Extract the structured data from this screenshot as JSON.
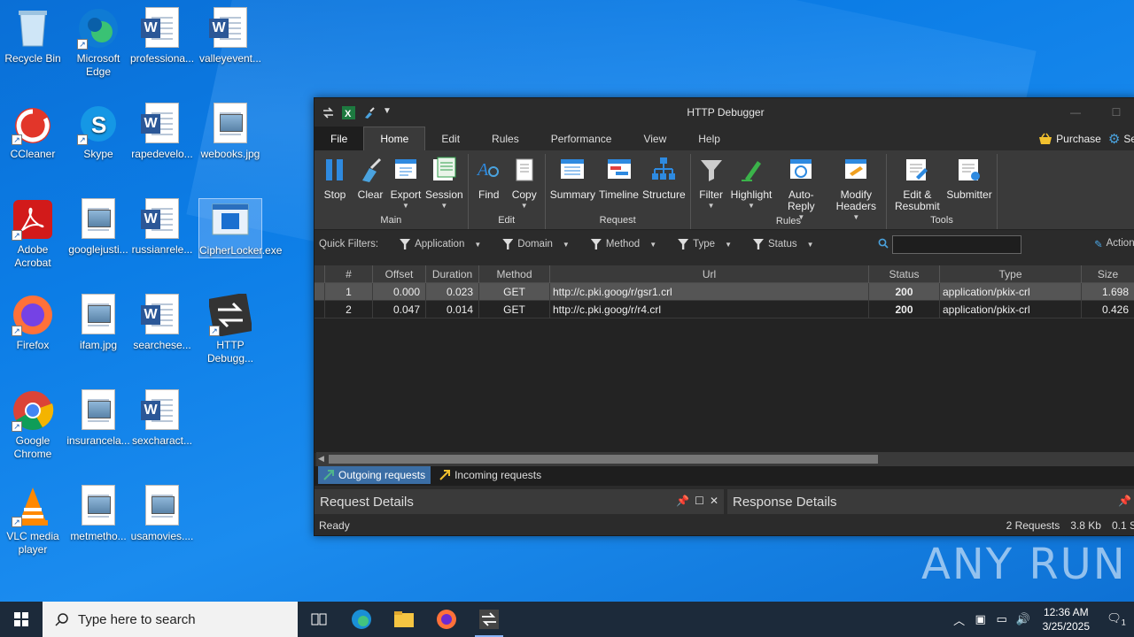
{
  "desktop": {
    "icons": [
      {
        "label": "Recycle Bin",
        "icon": "recycle-bin-icon"
      },
      {
        "label": "Microsoft Edge",
        "icon": "edge-icon"
      },
      {
        "label": "professiona...",
        "icon": "word-doc-icon"
      },
      {
        "label": "valleyevent...",
        "icon": "word-doc-icon"
      },
      {
        "label": "CCleaner",
        "icon": "ccleaner-icon"
      },
      {
        "label": "Skype",
        "icon": "skype-icon"
      },
      {
        "label": "rapedevelo...",
        "icon": "word-doc-icon"
      },
      {
        "label": "webooks.jpg",
        "icon": "image-file-icon"
      },
      {
        "label": "Adobe Acrobat",
        "icon": "acrobat-icon"
      },
      {
        "label": "googlejusti...",
        "icon": "image-file-icon"
      },
      {
        "label": "russianrele...",
        "icon": "word-doc-icon"
      },
      {
        "label": "CipherLocker.exe",
        "icon": "exe-icon"
      },
      {
        "label": "Firefox",
        "icon": "firefox-icon"
      },
      {
        "label": "ifam.jpg",
        "icon": "image-file-icon"
      },
      {
        "label": "searchese...",
        "icon": "word-doc-icon"
      },
      {
        "label": "HTTP Debugg...",
        "icon": "http-debugger-icon"
      },
      {
        "label": "Google Chrome",
        "icon": "chrome-icon"
      },
      {
        "label": "insurancela...",
        "icon": "image-file-icon"
      },
      {
        "label": "sexcharact...",
        "icon": "word-doc-icon"
      },
      {
        "label": "VLC media player",
        "icon": "vlc-icon"
      },
      {
        "label": "metmetho...",
        "icon": "image-file-icon"
      },
      {
        "label": "usamovies....",
        "icon": "image-file-icon"
      }
    ]
  },
  "window": {
    "title": "HTTP Debugger",
    "menu": {
      "file": "File",
      "items": [
        "Home",
        "Edit",
        "Rules",
        "Performance",
        "View",
        "Help"
      ],
      "active": "Home",
      "purchase": "Purchase",
      "settings": "Se"
    },
    "ribbon": {
      "groups": [
        {
          "label": "Main",
          "buttons": [
            {
              "label": "Stop",
              "icon": "stop-icon",
              "caret": false
            },
            {
              "label": "Clear",
              "icon": "clear-icon",
              "caret": false
            },
            {
              "label": "Export",
              "icon": "export-icon",
              "caret": true
            },
            {
              "label": "Session",
              "icon": "session-icon",
              "caret": true
            }
          ]
        },
        {
          "label": "Edit",
          "buttons": [
            {
              "label": "Find",
              "icon": "find-icon",
              "caret": false
            },
            {
              "label": "Copy",
              "icon": "copy-icon",
              "caret": true
            }
          ]
        },
        {
          "label": "Request",
          "buttons": [
            {
              "label": "Summary",
              "icon": "summary-icon",
              "caret": false
            },
            {
              "label": "Timeline",
              "icon": "timeline-icon",
              "caret": false
            },
            {
              "label": "Structure",
              "icon": "structure-icon",
              "caret": false
            }
          ]
        },
        {
          "label": "Rules",
          "buttons": [
            {
              "label": "Filter",
              "icon": "filter-icon",
              "caret": true
            },
            {
              "label": "Highlight",
              "icon": "highlight-icon",
              "caret": true
            },
            {
              "label": "Auto-Reply",
              "icon": "auto-reply-icon",
              "caret": true
            },
            {
              "label": "Modify Headers",
              "icon": "modify-headers-icon",
              "caret": true
            }
          ]
        },
        {
          "label": "Tools",
          "buttons": [
            {
              "label": "Edit & Resubmit",
              "icon": "edit-resubmit-icon",
              "caret": false
            },
            {
              "label": "Submitter",
              "icon": "submitter-icon",
              "caret": false
            }
          ]
        }
      ]
    },
    "quick_filters": {
      "label": "Quick Filters:",
      "filters": [
        "Application",
        "Domain",
        "Method",
        "Type",
        "Status"
      ],
      "search_value": "",
      "actions": "Action"
    },
    "grid": {
      "columns": [
        "#",
        "Offset",
        "Duration",
        "Method",
        "Url",
        "Status",
        "Type",
        "Size"
      ],
      "rows": [
        {
          "num": "1",
          "offset": "0.000",
          "duration": "0.023",
          "method": "GET",
          "url": "http://c.pki.goog/r/gsr1.crl",
          "status": "200",
          "type": "application/pkix-crl",
          "size": "1.698",
          "selected": true
        },
        {
          "num": "2",
          "offset": "0.047",
          "duration": "0.014",
          "method": "GET",
          "url": "http://c.pki.goog/r/r4.crl",
          "status": "200",
          "type": "application/pkix-crl",
          "size": "0.426",
          "selected": false
        }
      ]
    },
    "tabs": [
      "Outgoing requests",
      "Incoming requests"
    ],
    "active_tab": "Outgoing requests",
    "panels": {
      "request": "Request Details",
      "response": "Response Details"
    },
    "status": {
      "text": "Ready",
      "requests": "2 Requests",
      "size": "3.8 Kb",
      "time": "0.1 S"
    }
  },
  "taskbar": {
    "search_placeholder": "Type here to search",
    "time": "12:36 AM",
    "date": "3/25/2025",
    "notifications": "1"
  },
  "watermark": "ANY RUN"
}
